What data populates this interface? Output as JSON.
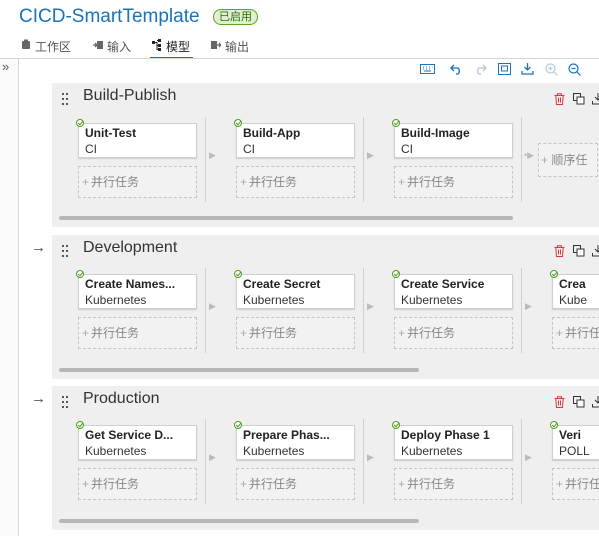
{
  "header": {
    "title": "CICD-SmartTemplate",
    "status_badge": "已启用",
    "tabs": [
      {
        "label": "工作区",
        "icon": "workspace-icon"
      },
      {
        "label": "输入",
        "icon": "input-icon"
      },
      {
        "label": "模型",
        "icon": "model-icon",
        "active": true
      },
      {
        "label": "输出",
        "icon": "output-icon"
      }
    ]
  },
  "rail": {
    "toggle": "»"
  },
  "toolbar": {
    "icons": [
      "keyboard-icon",
      "undo-icon",
      "redo-icon",
      "fit-view-icon",
      "download-icon",
      "zoom-in-icon",
      "zoom-out-icon"
    ]
  },
  "colors": {
    "accent": "#1a73b8",
    "delete": "#d9363e",
    "success": "#4c9c1d"
  },
  "parallel_label": "并行任务",
  "sequential_label": "顺序任务",
  "stages": [
    {
      "name": "Build-Publish",
      "tasks": [
        {
          "name": "Unit-Test",
          "type": "CI"
        },
        {
          "name": "Build-App",
          "type": "CI"
        },
        {
          "name": "Build-Image",
          "type": "CI"
        }
      ],
      "trailing": "顺序任"
    },
    {
      "name": "Development",
      "tasks": [
        {
          "name": "Create Names...",
          "type": "Kubernetes"
        },
        {
          "name": "Create Secret",
          "type": "Kubernetes"
        },
        {
          "name": "Create Service",
          "type": "Kubernetes"
        },
        {
          "name": "Crea",
          "type": "Kube"
        }
      ]
    },
    {
      "name": "Production",
      "tasks": [
        {
          "name": "Get Service D...",
          "type": "Kubernetes"
        },
        {
          "name": "Prepare Phas...",
          "type": "Kubernetes"
        },
        {
          "name": "Deploy Phase 1",
          "type": "Kubernetes"
        },
        {
          "name": "Veri",
          "type": "POLL"
        }
      ]
    }
  ]
}
